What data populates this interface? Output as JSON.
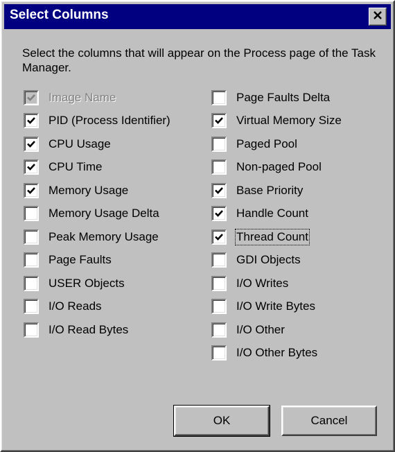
{
  "window": {
    "title": "Select Columns",
    "close_glyph": "×"
  },
  "intro_text": "Select the columns that will appear on the Process page of the Task Manager.",
  "left_column": [
    {
      "label": "Image Name",
      "checked": true,
      "disabled": true
    },
    {
      "label": "PID (Process Identifier)",
      "checked": true,
      "disabled": false
    },
    {
      "label": "CPU Usage",
      "checked": true,
      "disabled": false
    },
    {
      "label": "CPU Time",
      "checked": true,
      "disabled": false
    },
    {
      "label": "Memory Usage",
      "checked": true,
      "disabled": false
    },
    {
      "label": "Memory Usage Delta",
      "checked": false,
      "disabled": false
    },
    {
      "label": "Peak Memory Usage",
      "checked": false,
      "disabled": false
    },
    {
      "label": "Page Faults",
      "checked": false,
      "disabled": false
    },
    {
      "label": "USER Objects",
      "checked": false,
      "disabled": false
    },
    {
      "label": "I/O Reads",
      "checked": false,
      "disabled": false
    },
    {
      "label": "I/O Read Bytes",
      "checked": false,
      "disabled": false
    }
  ],
  "right_column": [
    {
      "label": "Page Faults Delta",
      "checked": false,
      "disabled": false
    },
    {
      "label": "Virtual Memory Size",
      "checked": true,
      "disabled": false
    },
    {
      "label": "Paged Pool",
      "checked": false,
      "disabled": false
    },
    {
      "label": "Non-paged Pool",
      "checked": false,
      "disabled": false
    },
    {
      "label": "Base Priority",
      "checked": true,
      "disabled": false
    },
    {
      "label": "Handle Count",
      "checked": true,
      "disabled": false
    },
    {
      "label": "Thread Count",
      "checked": true,
      "disabled": false,
      "focused": true
    },
    {
      "label": "GDI Objects",
      "checked": false,
      "disabled": false
    },
    {
      "label": "I/O Writes",
      "checked": false,
      "disabled": false
    },
    {
      "label": "I/O Write Bytes",
      "checked": false,
      "disabled": false
    },
    {
      "label": "I/O Other",
      "checked": false,
      "disabled": false
    },
    {
      "label": "I/O Other Bytes",
      "checked": false,
      "disabled": false
    }
  ],
  "buttons": {
    "ok_label": "OK",
    "cancel_label": "Cancel"
  },
  "colors": {
    "face": "#c0c0c0",
    "title_bar": "#000080",
    "title_text": "#ffffff"
  }
}
